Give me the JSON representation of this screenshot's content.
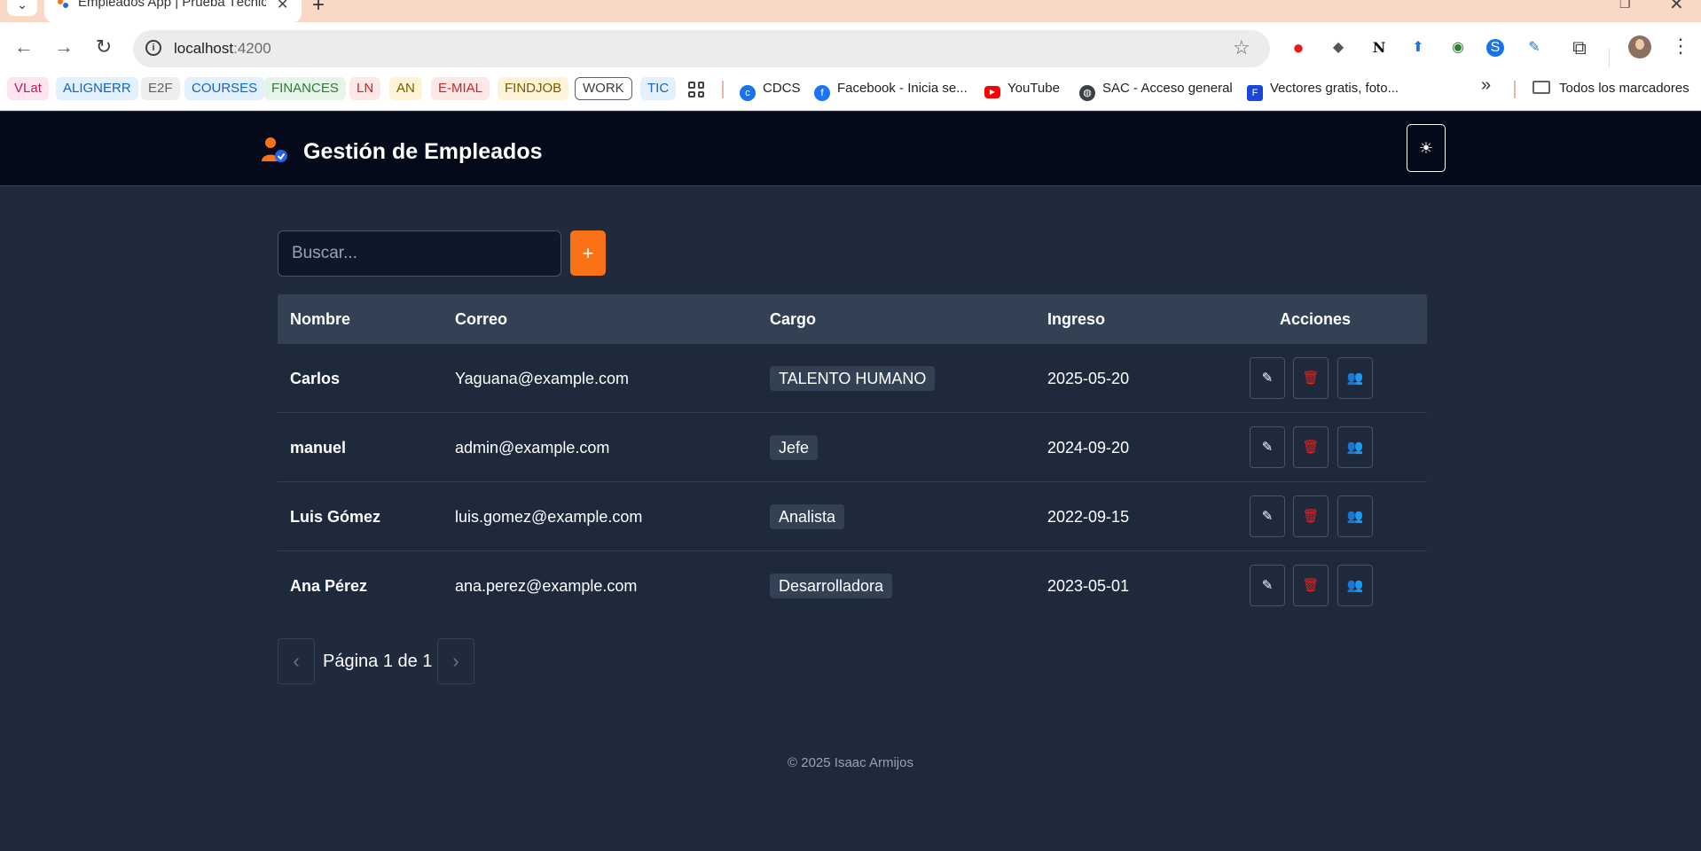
{
  "browser": {
    "tab_title": "Empleados App | Prueba Técnica",
    "url_host": "localhost",
    "url_port": ":4200",
    "bookmark_chips": [
      {
        "label": "VLat",
        "color": "#c2185b",
        "bg": "#fde4ef"
      },
      {
        "label": "ALIGNERR",
        "color": "#1565c0",
        "bg": "#e3f0fd"
      },
      {
        "label": "E2F",
        "color": "#5f6368",
        "bg": "#eeeeee"
      },
      {
        "label": "COURSES",
        "color": "#1565c0",
        "bg": "#e3f0fd"
      },
      {
        "label": "FINANCES",
        "color": "#2e7d32",
        "bg": "#e6f4ea"
      },
      {
        "label": "LN",
        "color": "#c62828",
        "bg": "#fde7e7"
      },
      {
        "label": "AN",
        "color": "#7a5c00",
        "bg": "#fdf3d6"
      },
      {
        "label": "E-MIAL",
        "color": "#c62828",
        "bg": "#fde7e7"
      },
      {
        "label": "FINDJOB",
        "color": "#7a5c00",
        "bg": "#fdf3d6"
      },
      {
        "label": "WORK",
        "color": "#3c4043",
        "bg": "#ffffff"
      },
      {
        "label": "TIC",
        "color": "#1565c0",
        "bg": "#e3f0fd"
      }
    ],
    "bookmarks": [
      {
        "label": "CDCS"
      },
      {
        "label": "Facebook - Inicia se..."
      },
      {
        "label": "YouTube"
      },
      {
        "label": "SAC - Acceso general"
      },
      {
        "label": "Vectores gratis, foto..."
      }
    ],
    "all_bookmarks": "Todos los marcadores"
  },
  "app": {
    "title": "Gestión de Empleados",
    "theme_icon": "sun-icon",
    "accent": "#f97316",
    "search": {
      "placeholder": "Buscar...",
      "value": ""
    },
    "add_label": "+",
    "table": {
      "headers": {
        "nombre": "Nombre",
        "correo": "Correo",
        "cargo": "Cargo",
        "ingreso": "Ingreso",
        "acciones": "Acciones"
      },
      "rows": [
        {
          "nombre": "Carlos",
          "correo": "Yaguana@example.com",
          "cargo": "TALENTO HUMANO",
          "ingreso": "2025-05-20"
        },
        {
          "nombre": "manuel",
          "correo": "admin@example.com",
          "cargo": "Jefe",
          "ingreso": "2024-09-20"
        },
        {
          "nombre": "Luis Gómez",
          "correo": "luis.gomez@example.com",
          "cargo": "Analista",
          "ingreso": "2022-09-15"
        },
        {
          "nombre": "Ana Pérez",
          "correo": "ana.perez@example.com",
          "cargo": "Desarrolladora",
          "ingreso": "2023-05-01"
        }
      ],
      "action_icons": [
        "edit-icon",
        "trash-icon",
        "users-icon"
      ]
    },
    "pagination": {
      "text": "Página 1 de 1",
      "current": 1,
      "total": 1
    },
    "footer": "© 2025 Isaac Armijos"
  }
}
